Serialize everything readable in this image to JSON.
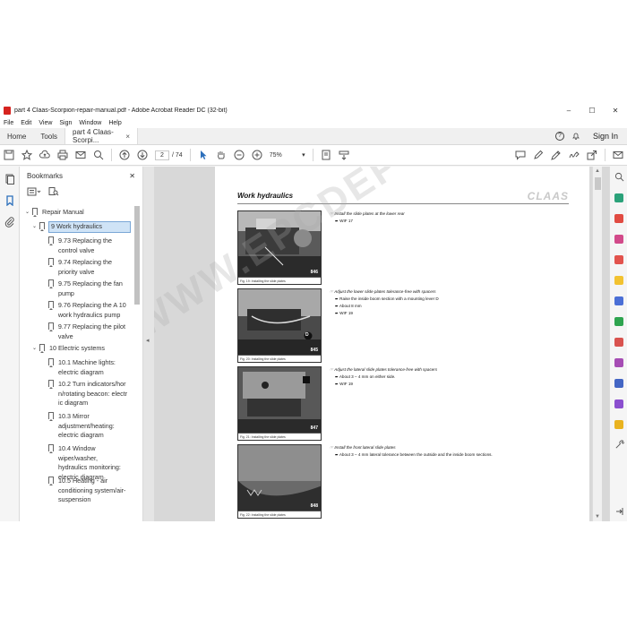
{
  "window": {
    "title": "part 4 Claas-Scorpion-repair-manual.pdf - Adobe Acrobat Reader DC (32-bit)",
    "minimize": "–",
    "maximize": "☐",
    "close": "✕"
  },
  "menu": [
    "File",
    "Edit",
    "View",
    "Sign",
    "Window",
    "Help"
  ],
  "tabs": {
    "home": "Home",
    "tools": "Tools",
    "doc": "part 4 Claas-Scorpi...",
    "doc_close": "×",
    "help": "?",
    "sign_in": "Sign In"
  },
  "toolbar": {
    "page_current": "2",
    "page_total": "/ 74",
    "zoom": "75%",
    "zoom_arrow": "▾"
  },
  "bookmarks": {
    "title": "Bookmarks",
    "close": "✕",
    "items": [
      {
        "label": "Repair Manual"
      },
      {
        "label": "9 Work hydraulics"
      },
      {
        "label": "9.73 Replacing the control valve"
      },
      {
        "label": "9.74 Replacing the priority valve"
      },
      {
        "label": "9.75 Replacing the fan pump"
      },
      {
        "label": "9.76 Replacing the A 10 work hydraulics pump"
      },
      {
        "label": "9.77 Replacing the pilot valve"
      },
      {
        "label": "10 Electric systems"
      },
      {
        "label": "10.1 Machine lights: electric diagram"
      },
      {
        "label": "10.2 Turn indicators/horn/rotating beacon: electric diagram"
      },
      {
        "label": "10.3 Mirror adjustment/heating: electric diagram"
      },
      {
        "label": "10.4 Window wiper/washer, hydraulics monitoring: electric diagram"
      },
      {
        "label": "10.5 Heating - air conditioning system/air-suspension"
      }
    ]
  },
  "page": {
    "section_title": "Work hydraulics",
    "logo": "CLAAS",
    "watermark": "WWW.EPCDEPO.COM",
    "figures": [
      {
        "caption": "Fig. 19:   Installing the slide plates",
        "number": "846"
      },
      {
        "caption": "Fig. 20:   Installing the slide plates",
        "number": "845",
        "marker": "D"
      },
      {
        "caption": "Fig. 21:   Installing the slide plates",
        "number": "847"
      },
      {
        "caption": "Fig. 22:   Installing the slide plates",
        "number": "848"
      }
    ],
    "instructions": [
      {
        "heading": "☞ Install the slide plates at the lower rear",
        "bullets": [
          "➨ WIF 17"
        ]
      },
      {
        "heading": "☞ Adjust the lower slide plates tolerance-free with spacers",
        "bullets": [
          "➨ Raise the inside boom section with a mounting lever D",
          "➨ About 8 mm",
          "➨ WIF 19"
        ]
      },
      {
        "heading": "☞ Adjust the lateral slide plates tolerance-free with spacers",
        "bullets": [
          "➨ About 3 – 4 mm on either side.",
          "➨ WIF 19"
        ]
      },
      {
        "heading": "☞ Install the front lateral slide plates",
        "bullets": [
          "➨ About 3 – 4 mm lateral tolerance between the outside and the inside boom sections."
        ]
      }
    ]
  },
  "colors": {
    "accent": "#2c6fbb",
    "selected_bookmark": "#cfe3f6",
    "pdf_icon": "#d6231f"
  },
  "icons": {
    "left_rail": [
      "page-thumbnails-icon",
      "bookmarks-icon",
      "attachments-icon"
    ],
    "right_rail": [
      "export-pdf-icon",
      "create-pdf-icon",
      "edit-pdf-icon",
      "combine-files-icon",
      "comment-icon",
      "organize-pages-icon",
      "scan-ocr-icon",
      "protect-icon",
      "fill-sign-icon",
      "send-for-review-icon",
      "more-tools-icon"
    ]
  }
}
